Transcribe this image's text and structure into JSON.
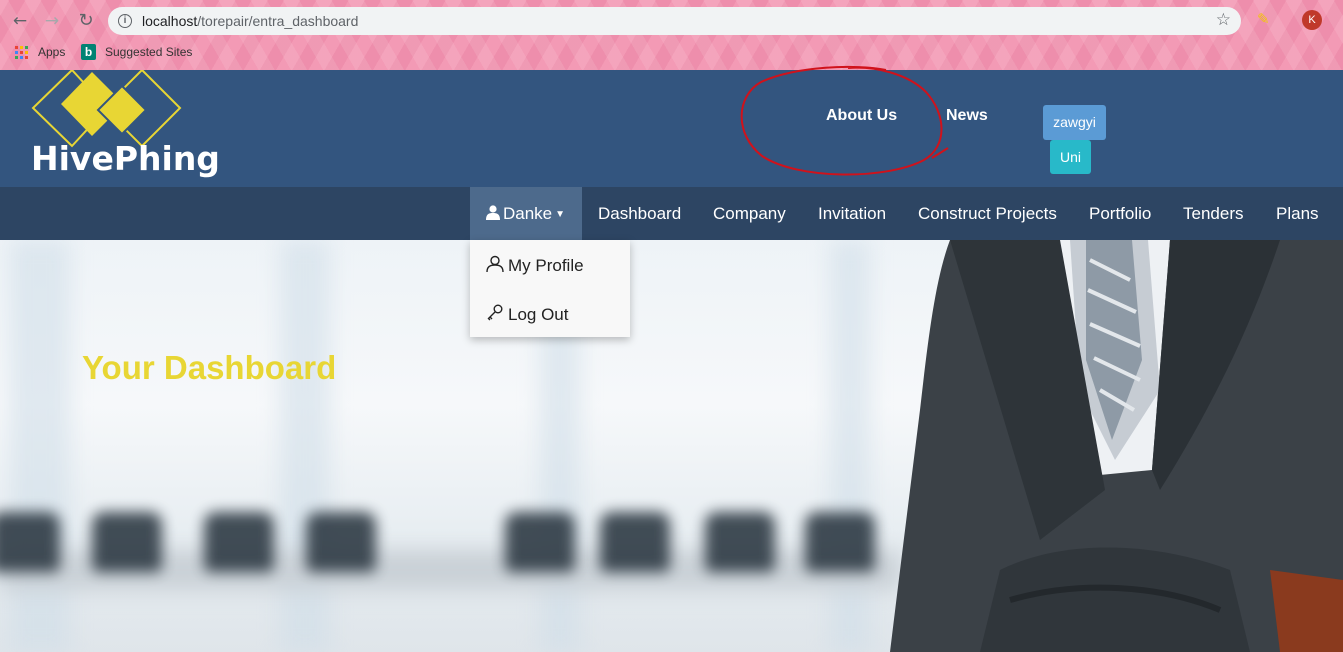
{
  "browser": {
    "url_host": "localhost",
    "url_path": "/torepair/entra_dashboard",
    "profile_initial": "K",
    "bookmarks": [
      {
        "label": "Apps",
        "icon": "apps-grid-icon"
      },
      {
        "label": "Suggested Sites",
        "icon": "bing-icon"
      }
    ],
    "bing_letter": "b",
    "chrome_color": "#f39ab5"
  },
  "header": {
    "logo_text": "HivePhing",
    "links": {
      "about": "About Us",
      "news": "News"
    },
    "lang_buttons": {
      "zawgyi": "zawgyi",
      "uni": "Uni"
    },
    "background": "#33557f",
    "annotation_color": "#d0121b"
  },
  "nav": {
    "user_label": "Danke",
    "items": [
      "Dashboard",
      "Company",
      "Invitation",
      "Construct Projects",
      "Portfolio",
      "Tenders",
      "Plans"
    ],
    "background": "#2d4563"
  },
  "dropdown": {
    "items": [
      {
        "label": "My Profile",
        "icon": "user-outline-icon"
      },
      {
        "label": "Log Out",
        "icon": "key-icon"
      }
    ]
  },
  "hero": {
    "title": "Your Dashboard",
    "title_color": "#e8d634"
  }
}
